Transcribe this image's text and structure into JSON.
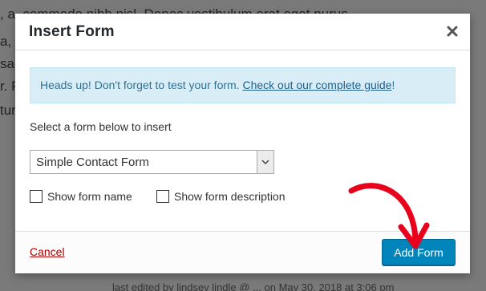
{
  "background": {
    "lines": [
      ", a, commodo nibh nisl. Donec vestibulum erat eget purus",
      "a, v",
      "sag",
      "r. Pe",
      "tur"
    ],
    "footer": "last edited by lindsey lindle @ ... on May 30, 2018 at 3:06 pm"
  },
  "modal": {
    "title": "Insert Form",
    "close_icon": "close-icon"
  },
  "notice": {
    "text": "Heads up! Don't forget to test your form. ",
    "link": "Check out our complete guide",
    "suffix": "!"
  },
  "form_select": {
    "label": "Select a form below to insert",
    "selected": "Simple Contact Form"
  },
  "options": {
    "show_name": "Show form name",
    "show_description": "Show form description"
  },
  "footer": {
    "cancel": "Cancel",
    "add": "Add Form"
  },
  "annotation": {
    "arrow_color": "#e8001c"
  }
}
